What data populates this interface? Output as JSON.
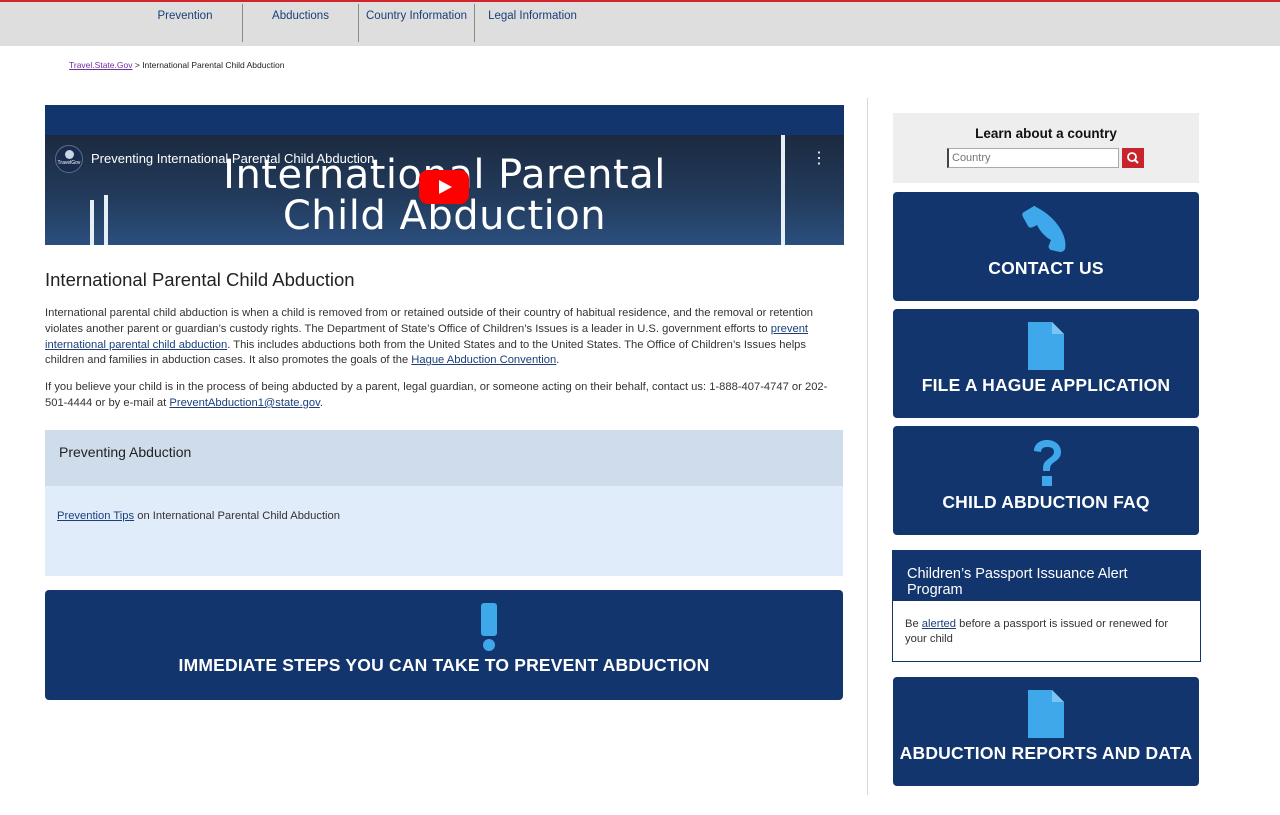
{
  "topnav": {
    "items": [
      "Prevention",
      "Abductions",
      "Country Information",
      "Legal Information"
    ]
  },
  "breadcrumb": {
    "home": "Travel.State.Gov",
    "separator": ">",
    "current": "International Parental Child Abduction"
  },
  "video": {
    "overlay_title": "Preventing International Parental Child Abduction",
    "bg_title_line1": "International Parental",
    "bg_title_line2": "Child Abduction",
    "channel": "TravelGov",
    "more_icon": "⋮"
  },
  "main": {
    "title": "International Parental Child Abduction",
    "p1_a": "International parental child abduction is when a child is removed from or retained outside of their country of habitual residence, and the removal or retention violates another parent or guardian’s custody rights. The Department of State’s Office of Children’s Issues is a leader in U.S. government efforts to ",
    "p1_link1": "prevent international parental child abduction",
    "p1_b": ". This includes abductions both from the United States and to the United States. The Office of Children’s Issues helps children and families in abduction cases. It also promotes the goals of the ",
    "p1_link2": "Hague Abduction Convention",
    "p1_c": ".",
    "p2_a": "If you believe your child is in the process of being abducted by a parent, legal guardian, or someone acting on their behalf, contact us: 1-888-407-4747 or 202-501-4444 or by e-mail at ",
    "p2_link": "PreventAbduction1@state.gov",
    "p2_b": ".",
    "accordion": {
      "title": "Preventing Abduction",
      "link": "Prevention Tips",
      "text": " on International Parental Child Abduction"
    },
    "immediate_label": "IMMEDIATE STEPS YOU CAN TAKE TO PREVENT ABDUCTION"
  },
  "sidebar": {
    "learn_title": "Learn about a country",
    "country_placeholder": "Country",
    "contact_label": "CONTACT US",
    "hague_label": "FILE A HAGUE APPLICATION",
    "faq_label": "CHILD ABDUCTION FAQ",
    "alert": {
      "title": "Children’s Passport Issuance Alert Program",
      "a": "Be ",
      "link": "alerted",
      "b": " before a passport is issued or renewed for your child"
    },
    "reports_label": "ABDUCTION REPORTS AND DATA"
  },
  "colors": {
    "navy": "#13356e",
    "icon_blue": "#3ea8ea",
    "alert_red": "#c8242c",
    "nav_red_line": "#d0232b"
  },
  "icons": {
    "contact": "phone-icon",
    "hague": "document-icon",
    "faq": "question-icon",
    "immediate": "exclamation-icon",
    "reports": "document-icon",
    "search": "search-icon"
  }
}
